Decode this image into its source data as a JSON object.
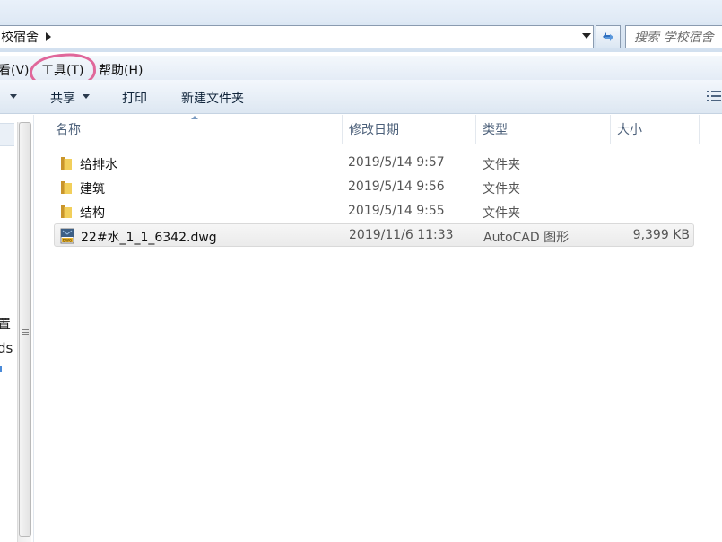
{
  "address": {
    "path_label": "校宿舍",
    "search_placeholder": "搜索 学校宿舍"
  },
  "menu": {
    "view": "看(V)",
    "tools": "工具(T)",
    "help": "帮助(H)"
  },
  "toolbar": {
    "share": "共享",
    "print": "打印",
    "new_folder": "新建文件夹"
  },
  "nav": {
    "item1": "置",
    "item2": "ds"
  },
  "columns": {
    "name": "名称",
    "date": "修改日期",
    "type": "类型",
    "size": "大小"
  },
  "files": [
    {
      "name": "给排水",
      "date": "2019/5/14 9:57",
      "type": "文件夹",
      "size": "",
      "icon": "folder-icon"
    },
    {
      "name": "建筑",
      "date": "2019/5/14 9:56",
      "type": "文件夹",
      "size": "",
      "icon": "folder-icon"
    },
    {
      "name": "结构",
      "date": "2019/5/14 9:55",
      "type": "文件夹",
      "size": "",
      "icon": "folder-icon"
    },
    {
      "name": "22#水_1_1_6342.dwg",
      "date": "2019/11/6 11:33",
      "type": "AutoCAD 图形",
      "size": "9,399 KB",
      "icon": "dwg-file-icon"
    }
  ],
  "colors": {
    "highlight_ring": "#e0679a",
    "toolbar_bg": "#dde7f2",
    "folder": "#e8c150"
  }
}
